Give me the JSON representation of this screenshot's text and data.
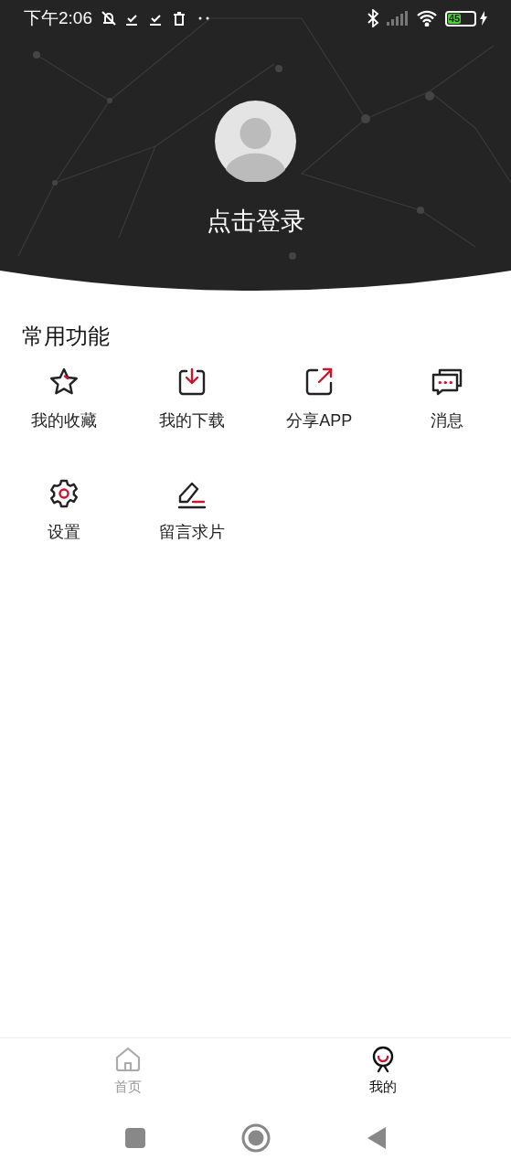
{
  "status_bar": {
    "time": "下午2:06",
    "battery": "45"
  },
  "profile": {
    "login_label": "点击登录"
  },
  "section": {
    "title": "常用功能",
    "items": [
      {
        "kind": "star",
        "label": "我的收藏"
      },
      {
        "kind": "download",
        "label": "我的下载"
      },
      {
        "kind": "share",
        "label": "分享APP"
      },
      {
        "kind": "message",
        "label": "消息"
      },
      {
        "kind": "settings",
        "label": "设置"
      },
      {
        "kind": "edit",
        "label": "留言求片"
      }
    ]
  },
  "tab_bar": [
    {
      "kind": "home",
      "label": "首页",
      "selected": false
    },
    {
      "kind": "profile",
      "label": "我的",
      "selected": true
    }
  ]
}
